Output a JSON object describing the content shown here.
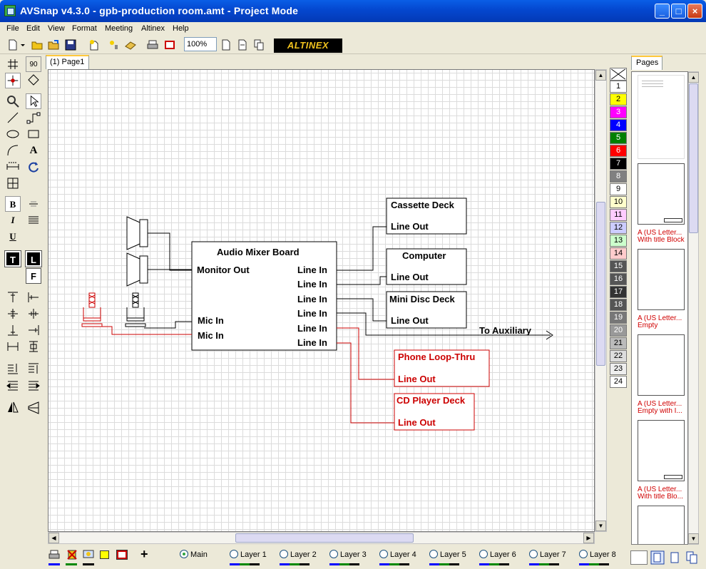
{
  "window": {
    "title": "AVSnap v4.3.0 - gpb-production room.amt - Project Mode"
  },
  "menu": [
    "File",
    "Edit",
    "View",
    "Format",
    "Meeting",
    "Altinex",
    "Help"
  ],
  "toolbar": {
    "zoom": "100%",
    "brand": "ALTINEX"
  },
  "tab": {
    "label": "(1) Page1"
  },
  "left_toolbar": {
    "t_label": "T",
    "l_label": "L",
    "f_label": "F",
    "b_label": "B",
    "i_label": "I",
    "u_label": "U",
    "a_label": "A",
    "ninety_label": "90"
  },
  "diagram": {
    "mixer": {
      "title": "Audio Mixer Board",
      "monitor_out": "Monitor Out",
      "mic_in": "Mic In",
      "line_in": "Line In"
    },
    "cassette": {
      "title": "Cassette Deck",
      "out": "Line Out"
    },
    "computer": {
      "title": "Computer",
      "out": "Line Out"
    },
    "minidisc": {
      "title": "Mini Disc Deck",
      "out": "Line Out"
    },
    "auxiliary": {
      "label": "To Auxiliary"
    },
    "phone": {
      "title": "Phone Loop-Thru",
      "out": "Line Out"
    },
    "cdplayer": {
      "title": "CD Player Deck",
      "out": "Line Out"
    },
    "colors": {
      "black": "#000000",
      "red": "#cc0000"
    }
  },
  "layers_palette": [
    "1",
    "2",
    "3",
    "4",
    "5",
    "6",
    "7",
    "8",
    "9",
    "10",
    "11",
    "12",
    "13",
    "14",
    "15",
    "16",
    "17",
    "18",
    "19",
    "20",
    "21",
    "22",
    "23",
    "24"
  ],
  "layer_colors": [
    "#ffffff",
    "#ffff00",
    "#ff00ff",
    "#0000ff",
    "#008000",
    "#ff0000",
    "#000000",
    "#808080",
    "#ffffff",
    "#ffffcc",
    "#ffccff",
    "#ccccff",
    "#ccffcc",
    "#ffcccc",
    "#555555",
    "#555555",
    "#333333",
    "#555555",
    "#777777",
    "#999999",
    "#bbbbbb",
    "#dddddd",
    "#eeeeee",
    "#ffffff"
  ],
  "pages": {
    "tab": "Pages",
    "items": [
      {
        "caption1": "",
        "caption2": ""
      },
      {
        "caption1": "A (US Letter...",
        "caption2": "With title Block"
      },
      {
        "caption1": "A (US Letter...",
        "caption2": "Empty"
      },
      {
        "caption1": "A (US Letter...",
        "caption2": "Empty with I..."
      },
      {
        "caption1": "A (US Letter...",
        "caption2": "With title Blo..."
      }
    ]
  },
  "statusbar": {
    "main": "Main",
    "layers": [
      "Layer 1",
      "Layer 2",
      "Layer 3",
      "Layer 4",
      "Layer 5",
      "Layer 6",
      "Layer 7",
      "Layer 8"
    ]
  }
}
